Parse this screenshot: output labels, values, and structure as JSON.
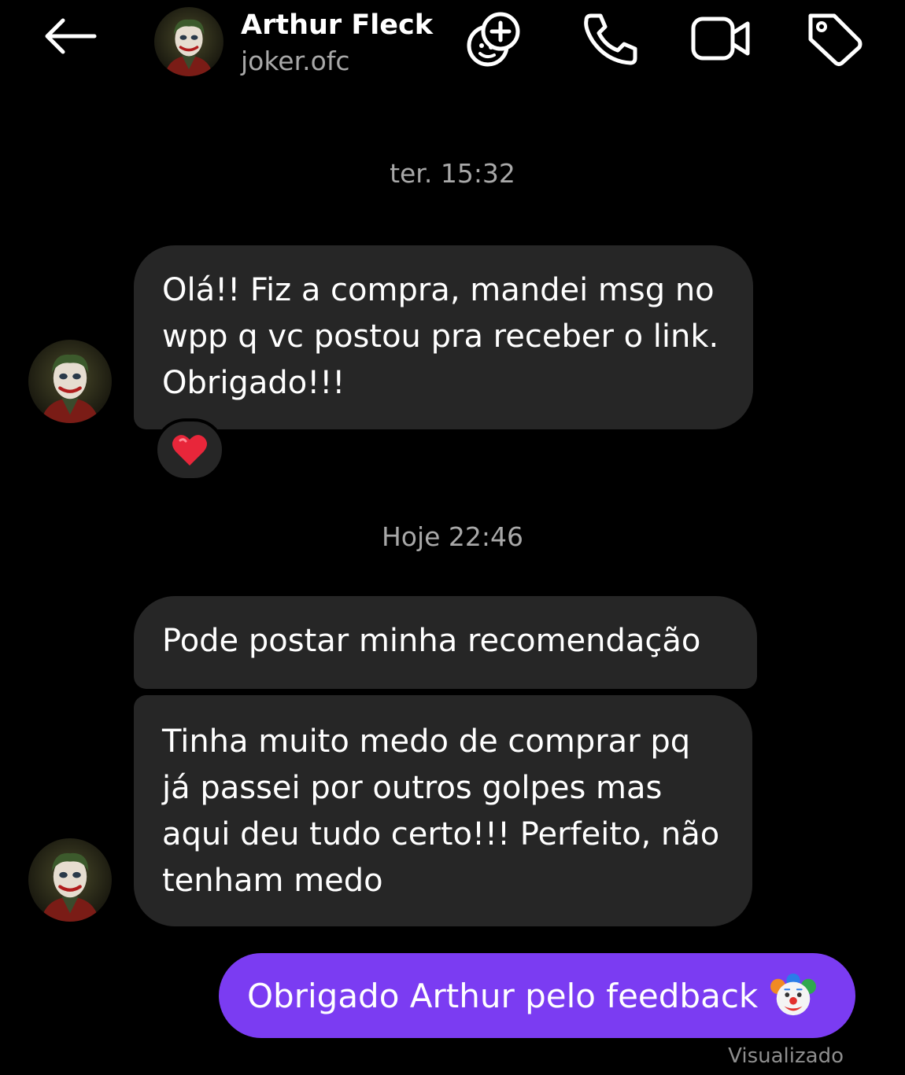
{
  "header": {
    "contact_name": "Arthur Fleck",
    "username": "joker.ofc",
    "icons": [
      "back-arrow-icon",
      "add-sticker-icon",
      "phone-icon",
      "video-camera-icon",
      "tag-icon"
    ]
  },
  "timestamps": {
    "first": "ter. 15:32",
    "second": "Hoje 22:46"
  },
  "messages": [
    {
      "from": "contact",
      "text": "Olá!! Fiz a compra, mandei msg no wpp q vc postou pra receber o link. Obrigado!!!",
      "reaction": "heart"
    },
    {
      "from": "contact",
      "text": "Pode postar minha recomendação"
    },
    {
      "from": "contact",
      "text": "Tinha muito medo de comprar pq já passei por outros golpes mas aqui deu tudo certo!!! Perfeito, não tenham medo"
    },
    {
      "from": "me",
      "text": "Obrigado Arthur pelo feedback",
      "emoji": "clown-face"
    }
  ],
  "status": "Visualizado",
  "colors": {
    "background": "#000000",
    "incoming_bubble": "#262626",
    "outgoing_bubble": "#7b3cf2",
    "secondary_text": "#a8a8a8"
  }
}
